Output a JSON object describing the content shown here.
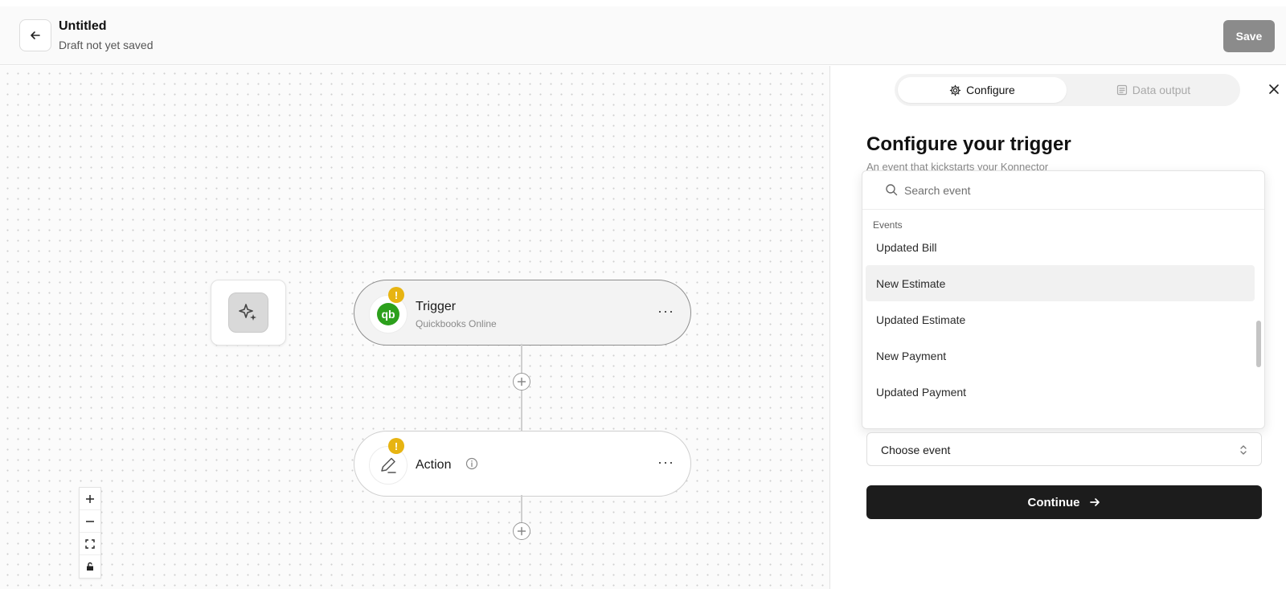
{
  "header": {
    "title": "Untitled",
    "subtitle": "Draft not yet saved",
    "save_label": "Save",
    "back_icon": "arrow-left-icon"
  },
  "canvas": {
    "ai_node_icon": "sparkles-icon",
    "trigger": {
      "title": "Trigger",
      "subtitle": "Quickbooks Online",
      "icon": "quickbooks-logo-icon",
      "more": "···",
      "warning": "!"
    },
    "action": {
      "title": "Action",
      "icon": "pencil-icon",
      "more": "···",
      "warning": "!"
    },
    "zoom_controls": [
      "zoom-in-icon",
      "zoom-out-icon",
      "fit-view-icon",
      "lock-icon"
    ]
  },
  "panel": {
    "tabs": [
      {
        "label": "Configure",
        "icon": "gear-icon",
        "active": true
      },
      {
        "label": "Data output",
        "icon": "document-icon",
        "active": false
      }
    ],
    "title": "Configure your trigger",
    "description": "An event that kickstarts your Konnector",
    "search": {
      "placeholder": "Search event",
      "value": ""
    },
    "group_label": "Events",
    "options": [
      "Updated Bill",
      "New Estimate",
      "Updated Estimate",
      "New Payment",
      "Updated Payment"
    ],
    "highlighted_option": "New Estimate",
    "select_label": "Choose event",
    "continue_label": "Continue"
  },
  "colors": {
    "save_bg": "#8b8b8b",
    "warning": "#e7b412",
    "quickbooks_green": "#2ca01c",
    "continue_bg": "#1c1c1c"
  }
}
